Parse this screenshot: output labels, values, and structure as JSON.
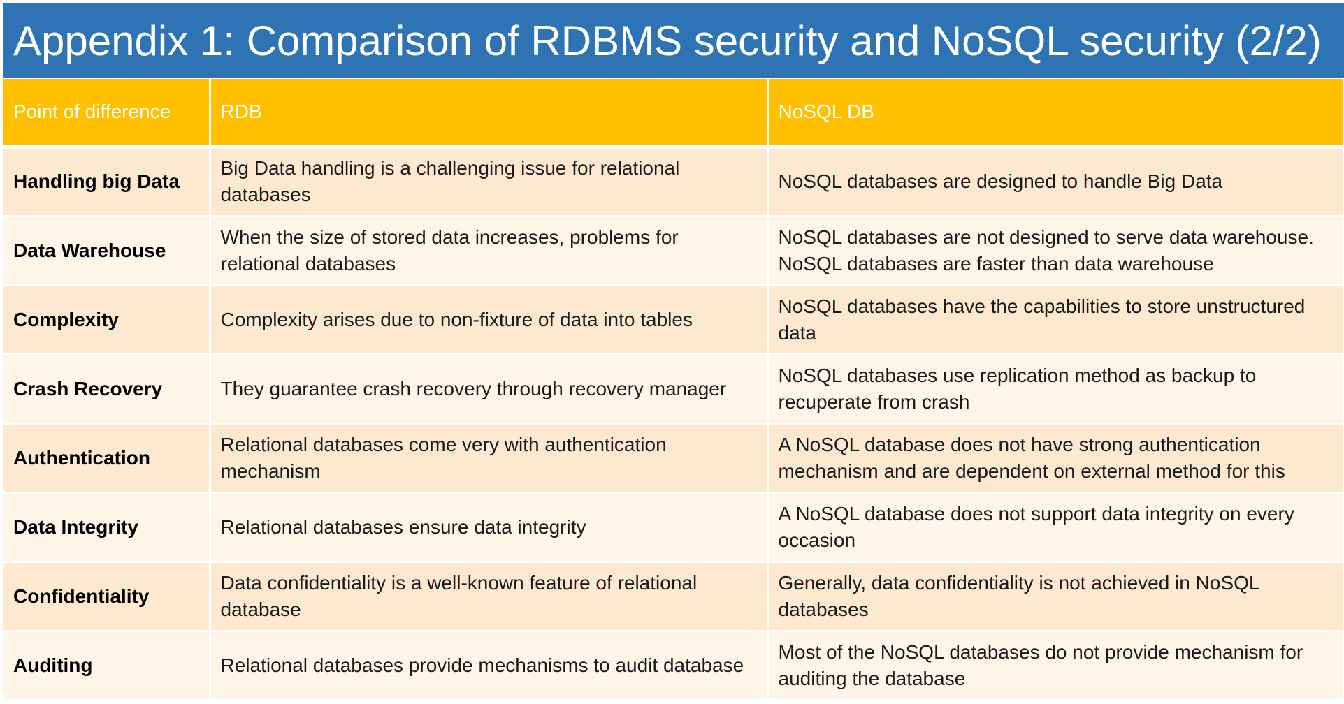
{
  "title": "Appendix 1: Comparison of RDBMS security and NoSQL security (2/2)",
  "table": {
    "headers": [
      "Point of difference",
      "RDB",
      "NoSQL DB"
    ],
    "rows": [
      {
        "point": "Handling big Data",
        "rdb": "Big Data handling is a challenging issue for relational databases",
        "nosql": "NoSQL databases are designed to handle Big Data"
      },
      {
        "point": "Data Warehouse",
        "rdb": "When the size of stored data increases, problems for relational databases",
        "nosql": "NoSQL databases are not designed to serve data warehouse. NoSQL databases are faster than data warehouse"
      },
      {
        "point": "Complexity",
        "rdb": "Complexity arises due to non-fixture of data into tables",
        "nosql": "NoSQL databases have the capabilities to store unstructured data"
      },
      {
        "point": "Crash Recovery",
        "rdb": "They guarantee crash recovery through recovery manager",
        "nosql": "NoSQL databases use replication method as backup to recuperate from crash"
      },
      {
        "point": "Authentication",
        "rdb": "Relational databases come very with authentication mechanism",
        "nosql": "A NoSQL database does not have strong authentication mechanism and are dependent on external method for this"
      },
      {
        "point": "Data Integrity",
        "rdb": "Relational databases ensure data integrity",
        "nosql": "A NoSQL database does not support data integrity on every occasion"
      },
      {
        "point": "Confidentiality",
        "rdb": "Data confidentiality is a well-known feature of relational database",
        "nosql": "Generally, data confidentiality is not achieved in NoSQL databases"
      },
      {
        "point": "Auditing",
        "rdb": "Relational databases provide mechanisms to audit database",
        "nosql": "Most of the NoSQL databases do not provide mechanism for auditing the database"
      }
    ]
  },
  "colors": {
    "title_bg": "#2e74b5",
    "header_bg": "#ffc000",
    "row_odd_bg": "#fde9d0",
    "row_even_bg": "#fef4e8"
  }
}
